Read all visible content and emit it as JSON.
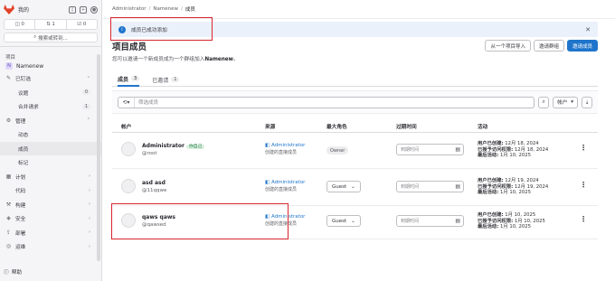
{
  "sidebar": {
    "title": "我的",
    "counts": [
      "0",
      "1",
      "0"
    ],
    "search": "搜索或转到...",
    "section_label": "项目",
    "project": {
      "avatar": "N",
      "name": "Namenew"
    },
    "items": [
      {
        "glyph": "✎",
        "label": "已钉选",
        "chev": "^"
      },
      {
        "label": "议题",
        "count": "0",
        "sub": true
      },
      {
        "label": "合并请求",
        "count": "1",
        "sub": true
      },
      {
        "glyph": "⚙",
        "label": "管理",
        "chev": "^"
      },
      {
        "label": "动态",
        "sub": true
      },
      {
        "label": "成员",
        "sub": true,
        "active": true
      },
      {
        "label": "标记",
        "sub": true
      },
      {
        "glyph": "▦",
        "label": "计划",
        "chev": ">"
      },
      {
        "glyph": "</>",
        "label": "代码",
        "chev": ">"
      },
      {
        "glyph": "⚒",
        "label": "构建",
        "chev": ">"
      },
      {
        "glyph": "◈",
        "label": "安全",
        "chev": ">"
      },
      {
        "glyph": "⇪",
        "label": "部署",
        "chev": ">"
      },
      {
        "glyph": "◎",
        "label": "运维",
        "chev": ">"
      }
    ],
    "help": "帮助"
  },
  "breadcrumb": [
    "Administrator",
    "Namenew",
    "成员"
  ],
  "alert": {
    "text": "成员已成功添加"
  },
  "header": {
    "title": "项目成员",
    "desc_prefix": "您可以邀请一个新成员成为一个群组加入",
    "desc_project": "Namenew",
    "desc_suffix": "。",
    "buttons": [
      "从一个项目导入",
      "邀请群组",
      "邀请成员"
    ]
  },
  "tabs": [
    {
      "label": "成员",
      "count": "3"
    },
    {
      "label": "已邀请",
      "count": "1"
    }
  ],
  "filter": {
    "placeholder": "筛选成员",
    "sort": "帐户"
  },
  "table": {
    "headers": [
      "帐户",
      "来源",
      "最大角色",
      "过期时间",
      "活动"
    ],
    "rows": [
      {
        "name": "Administrator",
        "badge": "你自己",
        "handle": "@root",
        "source": "Administrator",
        "source_note": "创建的直接成员",
        "role": "Owner",
        "expiry": "到期时间",
        "act1_label": "用户已创建:",
        "act1": "12月 18, 2024",
        "act2_label": "已授予访问权限:",
        "act2": "12月 18, 2024",
        "act3_label": "最后活动:",
        "act3": "1月 10, 2025"
      },
      {
        "name": "asd asd",
        "badge": "",
        "handle": "@11qqwe",
        "source": "Administrator",
        "source_note": "创建的直接成员",
        "role": "Guest",
        "expiry": "到期时间",
        "act1_label": "用户已创建:",
        "act1": "12月 19, 2024",
        "act2_label": "已授予访问权限:",
        "act2": "12月 19, 2024",
        "act3_label": "最后活动:",
        "act3": "1月 10, 2025"
      },
      {
        "name": "qaws qaws",
        "badge": "",
        "handle": "@qawsed",
        "source": "Administrator",
        "source_note": "创建的直接成员",
        "role": "Guest",
        "expiry": "到期时间",
        "act1_label": "用户已创建:",
        "act1": "1月 10, 2025",
        "act2_label": "已授予访问权限:",
        "act2": "1月 10, 2025",
        "act3_label": "最后活动:",
        "act3": "1月 10, 2025"
      }
    ]
  }
}
